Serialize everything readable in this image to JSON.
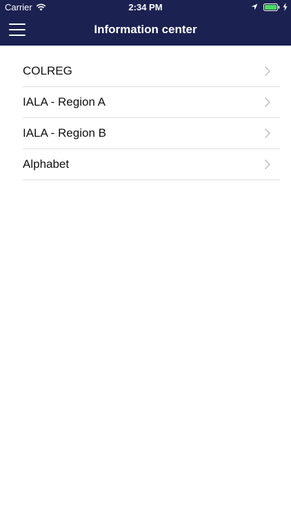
{
  "status_bar": {
    "carrier": "Carrier",
    "time": "2:34 PM",
    "icons": [
      "wifi-icon",
      "location-icon",
      "battery-icon",
      "charging-bolt-icon"
    ]
  },
  "nav": {
    "title": "Information center",
    "menu_icon": "hamburger-menu-icon",
    "background_color": "#1b2150"
  },
  "list": {
    "items": [
      {
        "label": "COLREG"
      },
      {
        "label": "IALA - Region A"
      },
      {
        "label": "IALA - Region B"
      },
      {
        "label": "Alphabet"
      }
    ],
    "chevron_icon": "chevron-right-icon"
  }
}
